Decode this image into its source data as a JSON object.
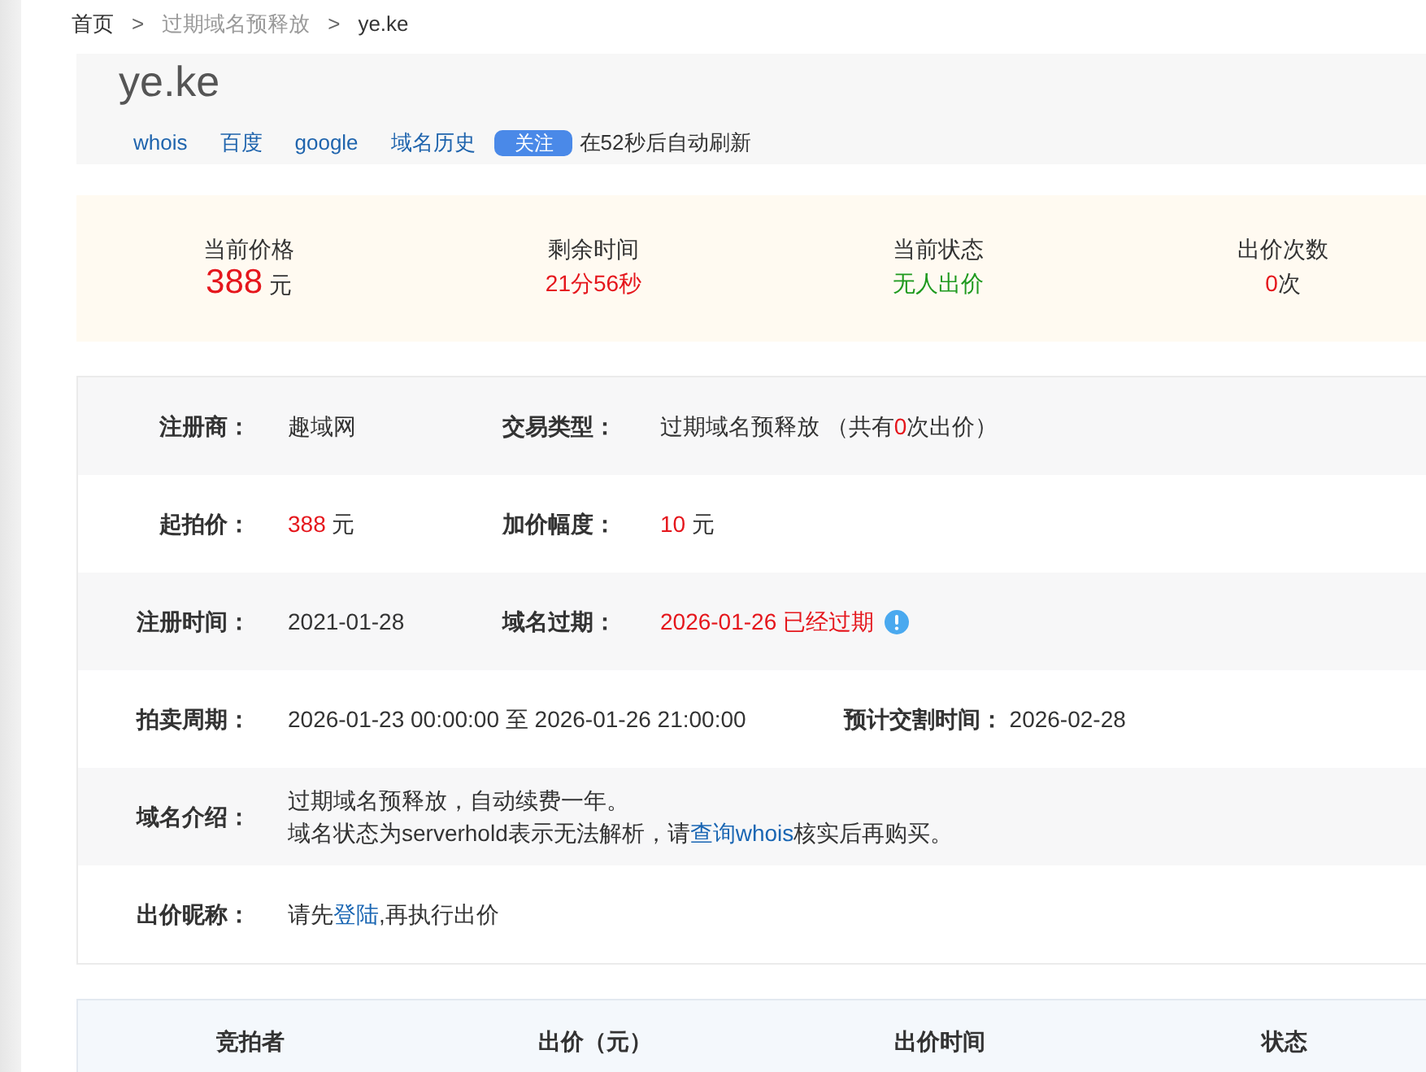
{
  "breadcrumb": [
    {
      "kind": "home",
      "text": "首页"
    },
    {
      "kind": "separator",
      "text": ">"
    },
    {
      "kind": "section",
      "text": "过期域名预释放"
    },
    {
      "kind": "separator",
      "text": ">"
    },
    {
      "kind": "current",
      "text": "ye.ke"
    }
  ],
  "header": {
    "title": "ye.ke",
    "links": [
      "whois",
      "百度",
      "google",
      "域名历史"
    ],
    "follow_button": "关注",
    "refresh_note": "在52秒后自动刷新"
  },
  "summary": [
    {
      "kind": "price",
      "label": "当前价格",
      "value": "388",
      "unit": "元"
    },
    {
      "kind": "countdown",
      "label": "剩余时间",
      "value": "21分56秒"
    },
    {
      "kind": "status",
      "label": "当前状态",
      "value": "无人出价"
    },
    {
      "kind": "count",
      "label": "出价次数",
      "value": "0",
      "unit": "次"
    }
  ],
  "details": [
    {
      "fields": [
        {
          "label": "注册商：",
          "lines": [
            [
              {
                "kind": "plain",
                "text": "趣域网"
              }
            ]
          ]
        },
        {
          "label": "交易类型：",
          "lines": [
            [
              {
                "kind": "plain",
                "text": "过期域名预释放 （共有"
              },
              {
                "kind": "red",
                "text": "0"
              },
              {
                "kind": "plain",
                "text": "次出价）"
              }
            ]
          ]
        }
      ]
    },
    {
      "fields": [
        {
          "label": "起拍价：",
          "lines": [
            [
              {
                "kind": "red",
                "text": "388"
              },
              {
                "kind": "plain",
                "text": " 元"
              }
            ]
          ]
        },
        {
          "label": "加价幅度：",
          "lines": [
            [
              {
                "kind": "red",
                "text": "10"
              },
              {
                "kind": "plain",
                "text": " 元"
              }
            ]
          ]
        }
      ]
    },
    {
      "fields": [
        {
          "label": "注册时间：",
          "lines": [
            [
              {
                "kind": "plain",
                "text": "2021-01-28"
              }
            ]
          ]
        },
        {
          "label": "域名过期：",
          "lines": [
            [
              {
                "kind": "red",
                "text": "2026-01-26 已经过期"
              }
            ]
          ],
          "notice": true
        }
      ]
    },
    {
      "fields": [
        {
          "label": "拍卖周期：",
          "lines": [
            [
              {
                "kind": "plain",
                "text": "2026-01-23 00:00:00 至 2026-01-26 21:00:00"
              }
            ]
          ]
        },
        {
          "label": "预计交割时间：",
          "lines": [
            [
              {
                "kind": "plain",
                "text": "2026-02-28"
              }
            ]
          ]
        }
      ]
    },
    {
      "fields": [
        {
          "label": "域名介绍：",
          "lines": [
            [
              {
                "kind": "plain",
                "text": "过期域名预释放，自动续费一年。"
              }
            ],
            [
              {
                "kind": "plain",
                "text": "域名状态为serverhold表示无法解析，请"
              },
              {
                "kind": "link",
                "text": "查询whois"
              },
              {
                "kind": "plain",
                "text": "核实后再购买。"
              }
            ]
          ]
        }
      ]
    },
    {
      "fields": [
        {
          "label": "出价昵称：",
          "lines": [
            [
              {
                "kind": "plain",
                "text": "请先"
              },
              {
                "kind": "link",
                "text": "登陆"
              },
              {
                "kind": "plain",
                "text": ",再执行出价"
              }
            ]
          ]
        }
      ]
    }
  ],
  "bid_table": {
    "columns": [
      "竞拍者",
      "出价（元）",
      "出价时间",
      "状态"
    ]
  }
}
